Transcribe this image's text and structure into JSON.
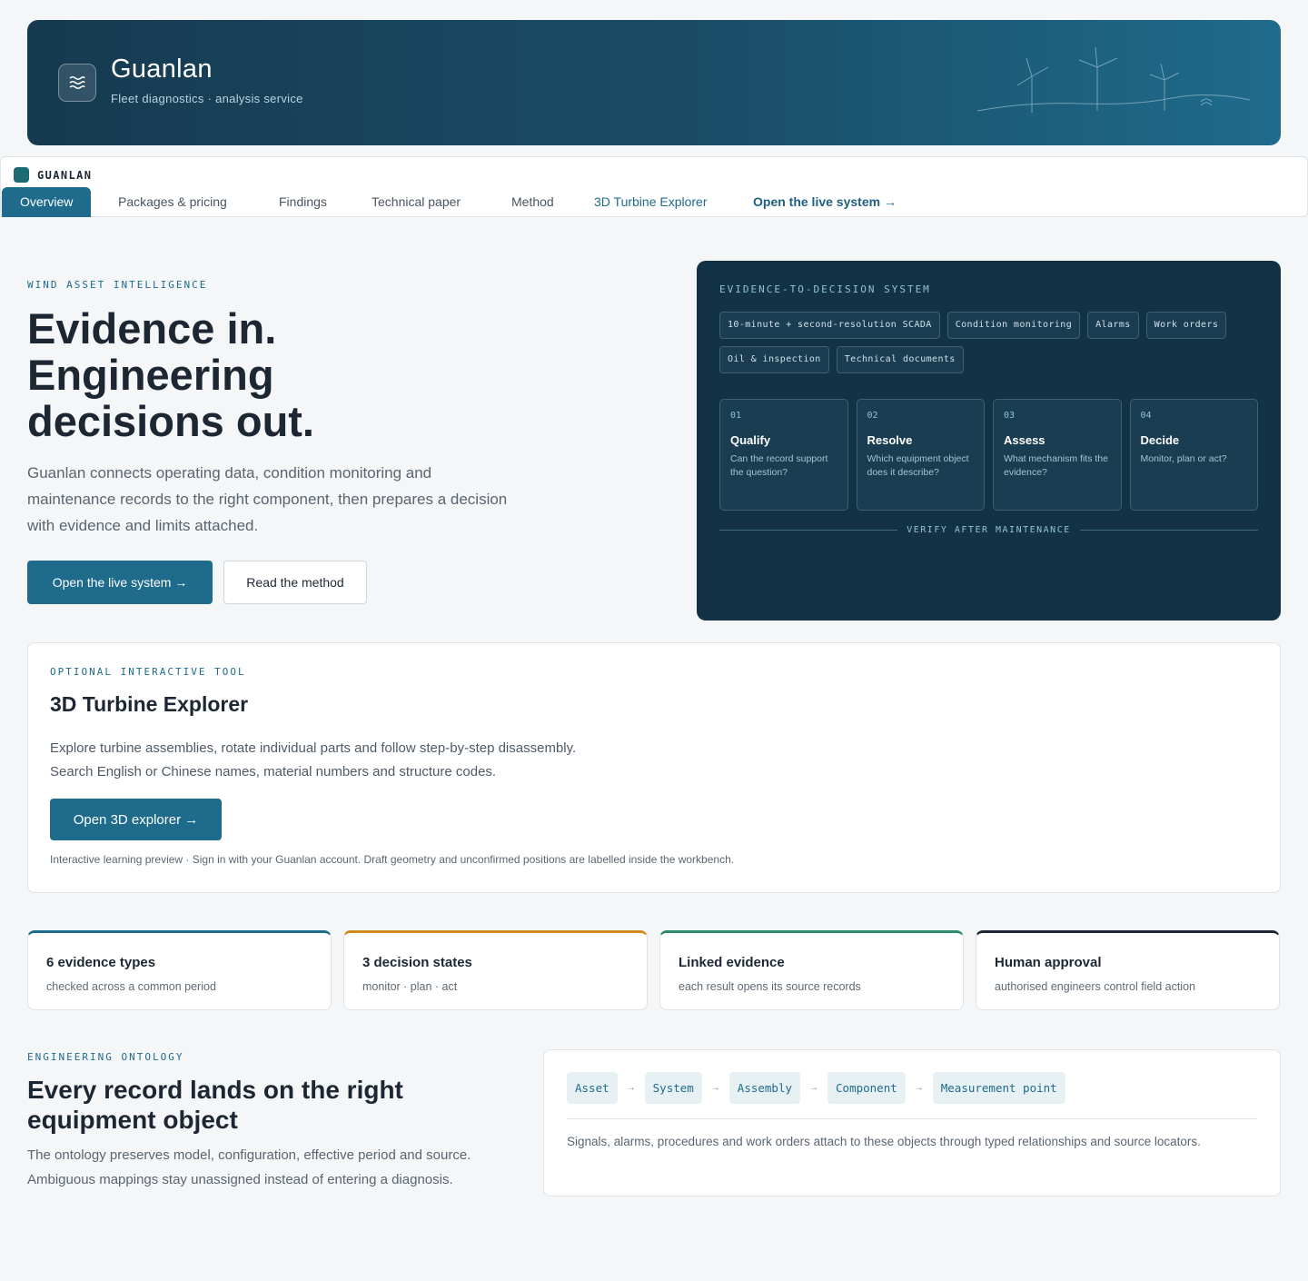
{
  "header": {
    "title": "Guanlan",
    "subtitle": "Fleet diagnostics · analysis service",
    "logo_icon": "waves-icon",
    "art_icon": "wind-turbines-illustration"
  },
  "nav": {
    "brand": "GUANLAN",
    "tabs": [
      {
        "label": "Overview",
        "active": true
      },
      {
        "label": "Packages & pricing"
      },
      {
        "label": "Findings"
      },
      {
        "label": "Technical paper"
      },
      {
        "label": "Method"
      },
      {
        "label": "3D Turbine Explorer"
      },
      {
        "label": "Open the live system →"
      }
    ]
  },
  "hero": {
    "eyebrow": "WIND ASSET INTELLIGENCE",
    "title": "Evidence in.\nEngineering\ndecisions out.",
    "description": "Guanlan connects operating data, condition monitoring and maintenance records to the right component, then prepares a decision with evidence and limits attached.",
    "primary_button": "Open the live system →",
    "secondary_button": "Read the method"
  },
  "panel": {
    "eyebrow": "EVIDENCE-TO-DECISION SYSTEM",
    "chips": [
      "10-minute + second-resolution SCADA",
      "Condition monitoring",
      "Alarms",
      "Work orders",
      "Oil & inspection",
      "Technical documents"
    ],
    "steps": [
      {
        "num": "01",
        "title": "Qualify",
        "desc": "Can the record support the question?"
      },
      {
        "num": "02",
        "title": "Resolve",
        "desc": "Which equipment object does it describe?"
      },
      {
        "num": "03",
        "title": "Assess",
        "desc": "What mechanism fits the evidence?"
      },
      {
        "num": "04",
        "title": "Decide",
        "desc": "Monitor, plan or act?"
      }
    ],
    "verify": "VERIFY AFTER MAINTENANCE"
  },
  "explorer": {
    "eyebrow": "OPTIONAL INTERACTIVE TOOL",
    "title": "3D Turbine Explorer",
    "desc_line1": "Explore turbine assemblies, rotate individual parts and follow step-by-step disassembly.",
    "desc_line2": "Search English or Chinese names, material numbers and structure codes.",
    "button": "Open 3D explorer →",
    "note": "Interactive learning preview · Sign in with your Guanlan account. Draft geometry and unconfirmed positions are labelled inside the workbench."
  },
  "stats": [
    {
      "title": "6 evidence types",
      "sub": "checked across a common period",
      "accent": "#1f6b8c"
    },
    {
      "title": "3 decision states",
      "sub": "monitor · plan · act",
      "accent": "#d08a1e"
    },
    {
      "title": "Linked evidence",
      "sub": "each result opens its source records",
      "accent": "#2e8a6a"
    },
    {
      "title": "Human approval",
      "sub": "authorised engineers control field action",
      "accent": "#1d2733"
    }
  ],
  "ontology": {
    "eyebrow": "ENGINEERING ONTOLOGY",
    "title": "Every record lands on the right equipment object",
    "desc": "The ontology preserves model, configuration, effective period and source. Ambiguous mappings stay unassigned instead of entering a diagnosis.",
    "path": [
      "Asset",
      "System",
      "Assembly",
      "Component",
      "Measurement point"
    ],
    "note": "Signals, alarms, procedures and work orders attach to these objects through typed relationships and source locators."
  },
  "colors": {
    "accent": "#1f6b8c",
    "panel_bg": "#143246",
    "page_bg": "#f4f6f7"
  }
}
